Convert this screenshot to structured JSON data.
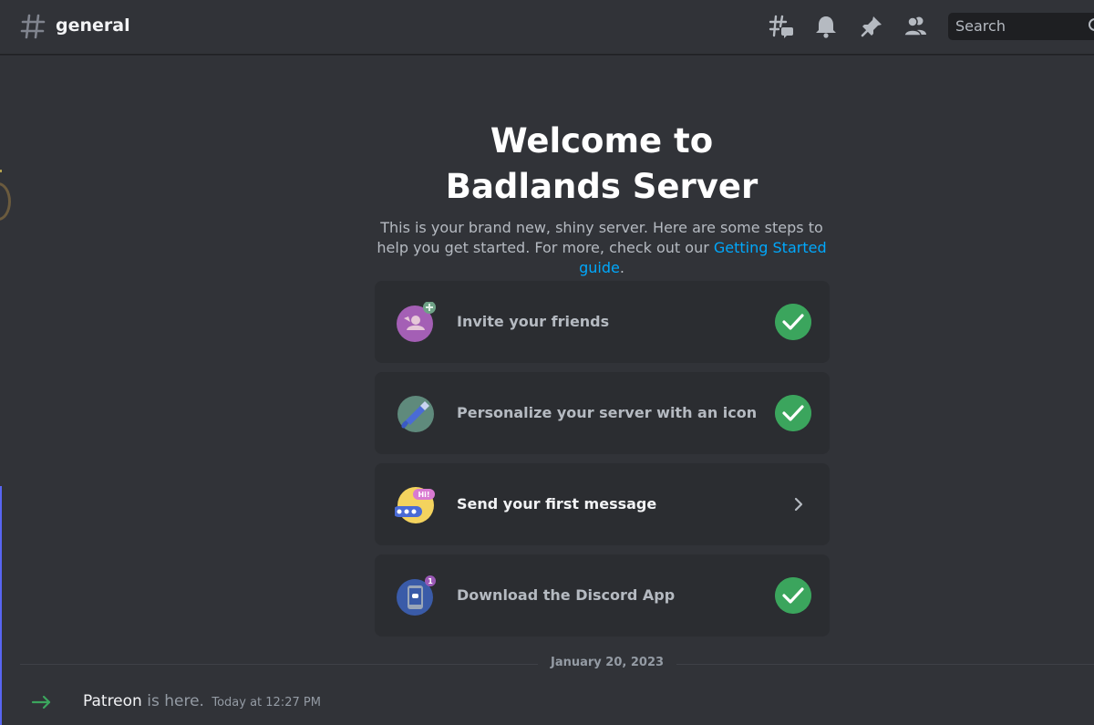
{
  "header": {
    "channel_name": "general",
    "search_placeholder": "Search",
    "tools": [
      "threads-icon",
      "bell-icon",
      "pin-icon",
      "members-icon"
    ]
  },
  "welcome": {
    "title_line1": "Welcome to",
    "title_line2": "Badlands Server",
    "intro_text": "This is your brand new, shiny server. Here are some steps to help you get started. For more, check out our",
    "intro_link": "Getting Started guide",
    "intro_end": "."
  },
  "checklist": [
    {
      "label": "Invite your friends",
      "icon": "invite-friends-icon",
      "status": "done"
    },
    {
      "label": "Personalize your server with an icon",
      "icon": "paintbrush-icon",
      "status": "done"
    },
    {
      "label": "Send your first message",
      "icon": "chat-bubble-icon",
      "status": "todo",
      "badge": "Hi!"
    },
    {
      "label": "Download the Discord App",
      "icon": "phone-app-icon",
      "status": "done",
      "badge": "1"
    }
  ],
  "divider": {
    "date": "January 20, 2023"
  },
  "message": {
    "user": "Patreon",
    "text": "is here.",
    "timestamp": "Today at 12:27 PM"
  },
  "colors": {
    "background": "#313338",
    "card": "#2b2d31",
    "check": "#3ba55d",
    "link": "#00a8fc",
    "join_arrow": "#3ba55d"
  }
}
